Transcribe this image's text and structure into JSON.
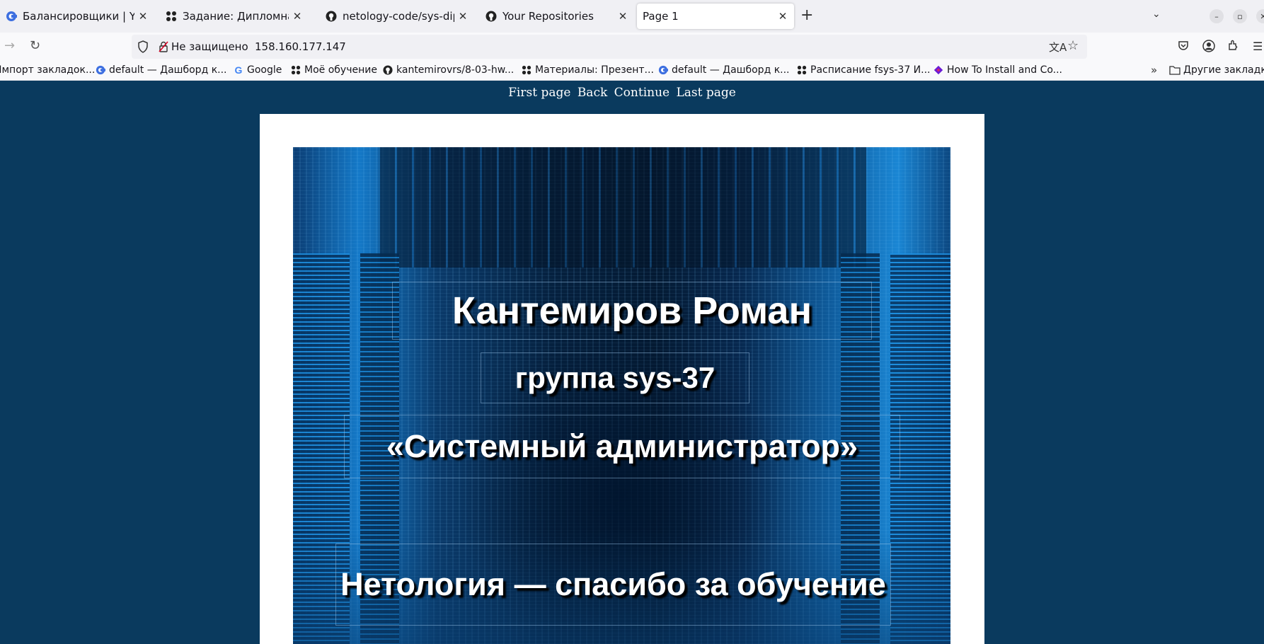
{
  "browser": {
    "tabs": [
      {
        "title": "Балансировщики | Yandex",
        "icon": "yandex-cloud-icon",
        "active": false
      },
      {
        "title": "Задание: Дипломная работа",
        "icon": "netology-icon",
        "active": false
      },
      {
        "title": "netology-code/sys-diplom",
        "icon": "github-icon",
        "active": false
      },
      {
        "title": "Your Repositories",
        "icon": "github-icon",
        "active": false
      },
      {
        "title": "Page 1",
        "icon": "",
        "active": true
      }
    ],
    "new_tab_symbol": "+",
    "url": {
      "security_label": "Не защищено",
      "address": "158.160.177.147"
    },
    "bookmarks": [
      {
        "label": "Импорт закладок...",
        "icon": ""
      },
      {
        "label": "default — Дашборд к...",
        "icon": "yandex-cloud-icon"
      },
      {
        "label": "Google",
        "icon": "google-icon"
      },
      {
        "label": "Моё обучение",
        "icon": "netology-icon"
      },
      {
        "label": "kantemirovrs/8-03-hw...",
        "icon": "github-icon"
      },
      {
        "label": "Материалы: Презент...",
        "icon": "netology-icon"
      },
      {
        "label": "default — Дашборд к...",
        "icon": "yandex-cloud-icon"
      },
      {
        "label": "Расписание fsys-37 И...",
        "icon": "netology-icon"
      },
      {
        "label": "How To Install and Co...",
        "icon": "digitalocean-icon"
      }
    ],
    "other_bookmarks": "Другие закладки"
  },
  "page": {
    "nav": {
      "first": "First page",
      "back": "Back",
      "continue": "Continue",
      "last": "Last page"
    },
    "slide": {
      "name": "Кантемиров Роман",
      "group": "группа sys-37",
      "role": "«Системный администратор»",
      "thanks": "Нетология — спасибо за обучение"
    }
  },
  "colors": {
    "page_background": "#0a3a5e",
    "slide_text": "#ffffff",
    "text_shadow": "#000000"
  }
}
